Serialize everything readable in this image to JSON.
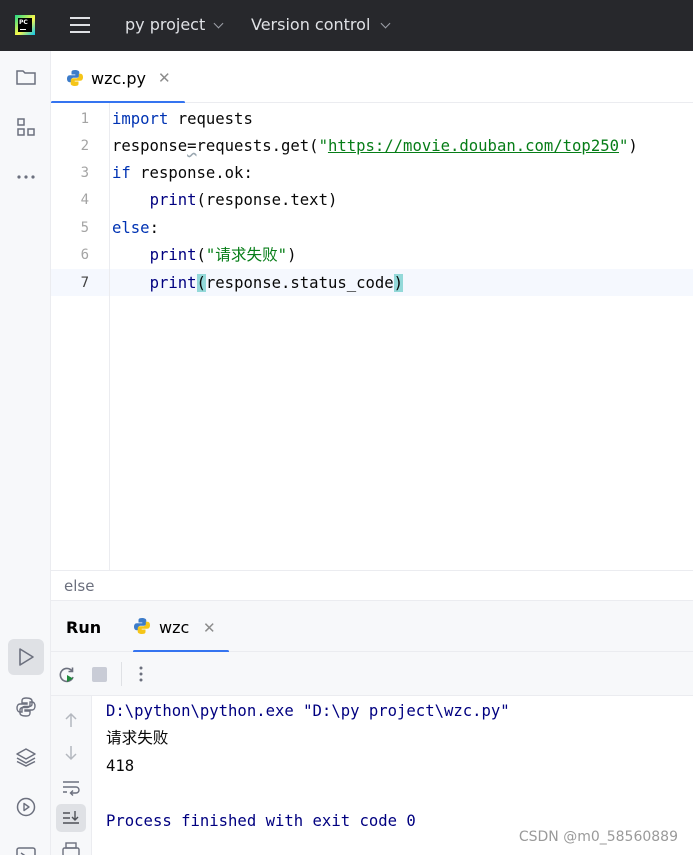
{
  "titlebar": {
    "logo_text": "PC",
    "project": "py project",
    "vcs": "Version control"
  },
  "editor_tabs": [
    {
      "label": "wzc.py"
    }
  ],
  "editor": {
    "line_numbers": [
      "1",
      "2",
      "3",
      "4",
      "5",
      "6",
      "7"
    ],
    "current_line": 7,
    "lines": {
      "l1_kw": "import",
      "l1_rest": " requests",
      "l2_a": "response",
      "l2_eq": "=",
      "l2_b": "requests.get(",
      "l2_q1": "\"",
      "l2_url": "https://movie.douban.com/top250",
      "l2_q2": "\"",
      "l2_end": ")",
      "l3_kw": "if",
      "l3_rest": " response.ok:",
      "l4_indent": "    ",
      "l4_fn": "print",
      "l4_rest": "(response.text)",
      "l5_kw": "else",
      "l5_rest": ":",
      "l6_indent": "    ",
      "l6_fn": "print",
      "l6_p1": "(",
      "l6_str": "\"请求失败\"",
      "l6_p2": ")",
      "l7_indent": "    ",
      "l7_fn": "print",
      "l7_p1": "(",
      "l7_mid": "response.status_code",
      "l7_p2": ")"
    }
  },
  "breadcrumb": "else",
  "run_panel": {
    "title": "Run",
    "tab_label": "wzc",
    "console": [
      {
        "type": "sys",
        "text": "D:\\python\\python.exe \"D:\\py project\\wzc.py\""
      },
      {
        "type": "out",
        "text": "请求失败"
      },
      {
        "type": "out",
        "text": "418"
      },
      {
        "type": "sys",
        "text": "Process finished with exit code 0"
      }
    ]
  },
  "watermark": "CSDN @m0_58560889",
  "colors": {
    "keyword": "#0033b3",
    "string": "#067d17",
    "builtin": "#000080",
    "accent": "#3574f0",
    "titlebar": "#27282c"
  },
  "icons": [
    "pycharm-logo-icon",
    "hamburger-menu-icon",
    "chevron-down-icon",
    "folder-icon",
    "structure-icon",
    "more-icon",
    "run-icon",
    "python-console-icon",
    "layers-icon",
    "services-icon",
    "terminal-icon",
    "python-file-icon",
    "close-icon",
    "rerun-icon",
    "stop-icon",
    "kebab-menu-icon",
    "arrow-up-icon",
    "arrow-down-icon",
    "soft-wrap-icon",
    "scroll-to-end-icon",
    "print-icon"
  ]
}
